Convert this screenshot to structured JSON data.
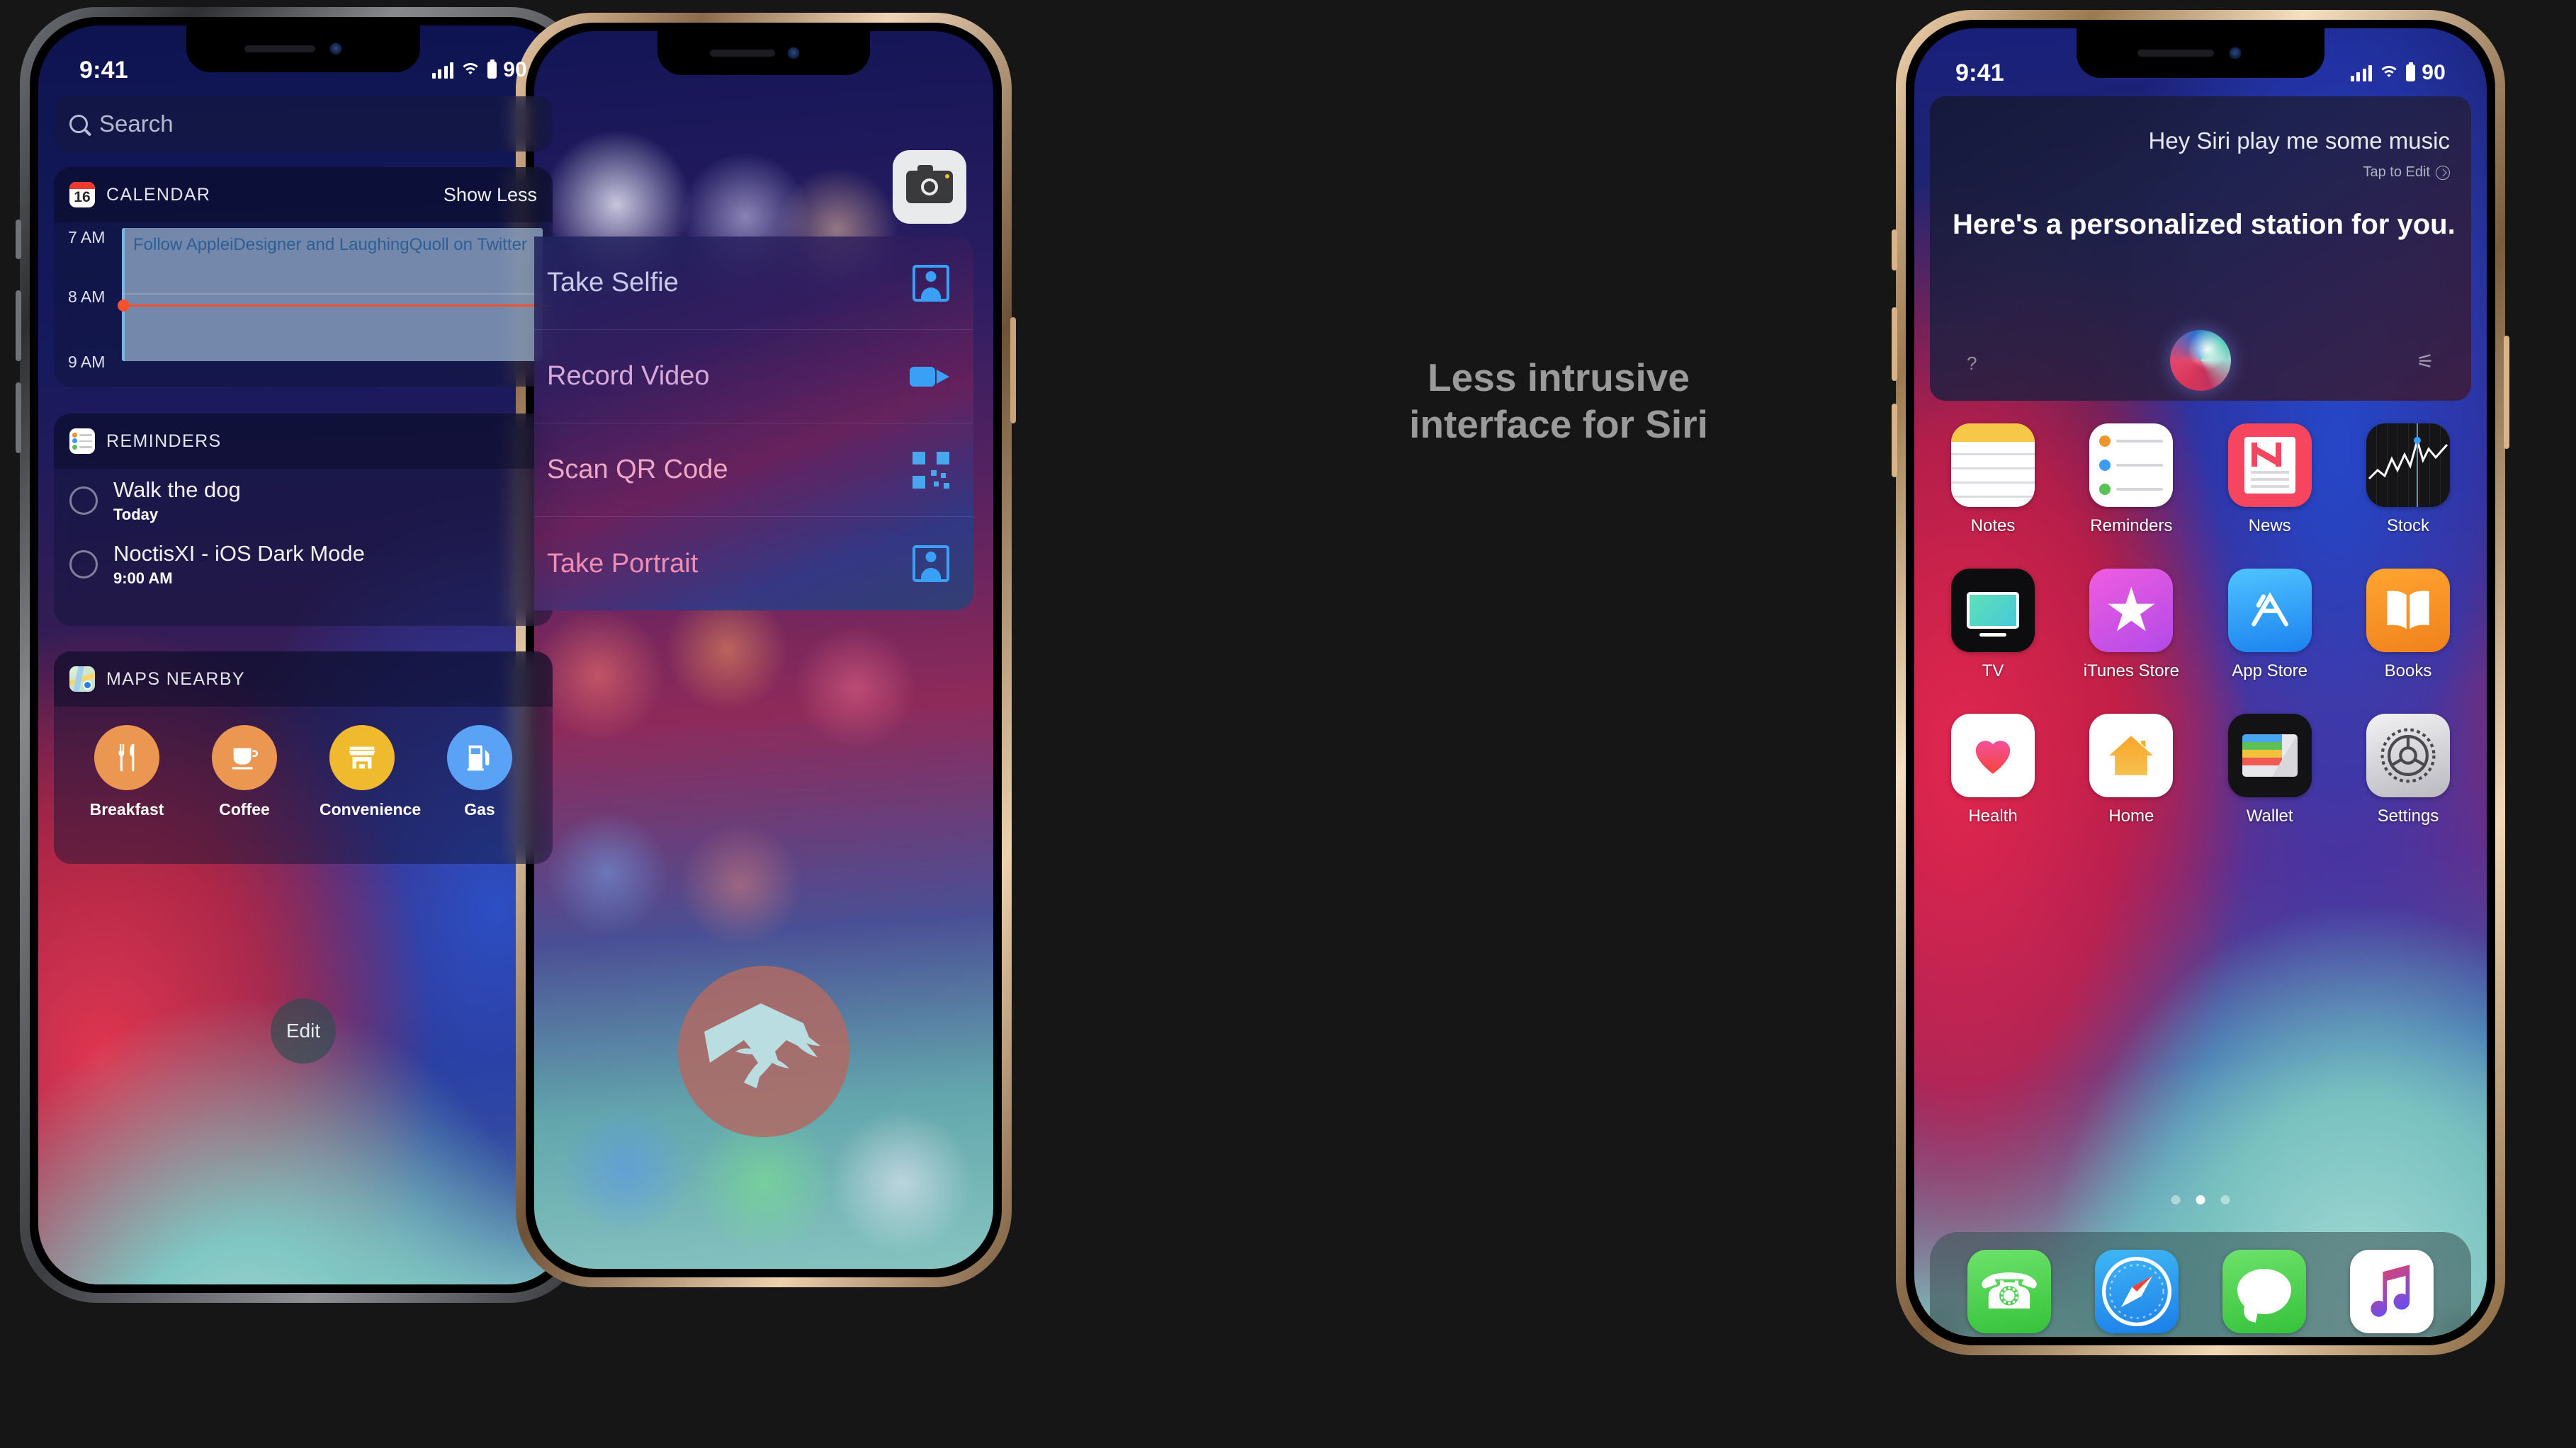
{
  "headline": {
    "line1": "Less intrusive",
    "line2": "interface for Siri",
    "color": "#9a9a9a"
  },
  "status_bar": {
    "time": "9:41",
    "battery_percent": "90",
    "signal_icon": "cellular-bars-icon",
    "wifi_icon": "wifi-icon",
    "battery_icon": "battery-icon"
  },
  "phone1": {
    "name": "Today View / Widgets",
    "search": {
      "placeholder": "Search",
      "icon": "search-icon"
    },
    "widgets": [
      {
        "id": "calendar",
        "title": "CALENDAR",
        "icon": "calendar-icon",
        "icon_day": "16",
        "action": "Show Less",
        "hours": [
          "7 AM",
          "8 AM",
          "9 AM"
        ],
        "event": {
          "title": "Follow AppleiDesigner and LaughingQuoll on Twitter"
        },
        "now_indicator_color": "#f4522e"
      },
      {
        "id": "reminders",
        "title": "REMINDERS",
        "icon": "reminders-icon",
        "items": [
          {
            "title": "Walk the dog",
            "subtitle": "Today"
          },
          {
            "title": "NoctisXI - iOS Dark Mode",
            "subtitle": "9:00 AM"
          }
        ]
      },
      {
        "id": "maps-nearby",
        "title": "MAPS NEARBY",
        "icon": "maps-icon",
        "categories": [
          {
            "label": "Breakfast",
            "icon": "fork-knife-icon",
            "color": "#ec9751"
          },
          {
            "label": "Coffee",
            "icon": "coffee-cup-icon",
            "color": "#ec9751"
          },
          {
            "label": "Convenience",
            "icon": "store-icon",
            "color": "#f0ba2e"
          },
          {
            "label": "Gas",
            "icon": "fuel-pump-icon",
            "color": "#5aa2f5"
          }
        ]
      }
    ],
    "edit_button": "Edit"
  },
  "phone2": {
    "name": "Camera quick actions",
    "app_icon": "camera-icon",
    "menu_items": [
      {
        "label": "Take Selfie",
        "icon": "portrait-person-icon",
        "color": "#c8c8e8"
      },
      {
        "label": "Record Video",
        "icon": "video-camera-icon",
        "color": "#d7a9d8"
      },
      {
        "label": "Scan QR Code",
        "icon": "qr-code-icon",
        "color": "#eda7c2"
      },
      {
        "label": "Take Portrait",
        "icon": "portrait-person-icon",
        "color": "#f08cb2"
      }
    ],
    "watermark": "quoll-logo-icon"
  },
  "phone3": {
    "name": "Siri result + Home screen",
    "siri": {
      "query": "Hey Siri play me some music",
      "edit_hint": "Tap to Edit",
      "edit_icon": "chevron-right-icon",
      "response": "Here's a personalized station for you.",
      "orb_icon": "siri-orb-icon",
      "help_icon": "help-question-icon",
      "mic_icon": "bluetooth-mic-icon"
    },
    "apps": [
      [
        {
          "label": "Notes",
          "icon": "notes-icon"
        },
        {
          "label": "Reminders",
          "icon": "reminders-icon"
        },
        {
          "label": "News",
          "icon": "news-icon"
        },
        {
          "label": "Stock",
          "icon": "stocks-icon"
        }
      ],
      [
        {
          "label": "TV",
          "icon": "tv-icon"
        },
        {
          "label": "iTunes Store",
          "icon": "itunes-store-icon"
        },
        {
          "label": "App Store",
          "icon": "app-store-icon"
        },
        {
          "label": "Books",
          "icon": "books-icon"
        }
      ],
      [
        {
          "label": "Health",
          "icon": "health-icon"
        },
        {
          "label": "Home",
          "icon": "home-icon"
        },
        {
          "label": "Wallet",
          "icon": "wallet-icon"
        },
        {
          "label": "Settings",
          "icon": "settings-gear-icon"
        }
      ]
    ],
    "page_dots": {
      "count": 3,
      "active_index": 1
    },
    "dock": [
      {
        "label": "Phone",
        "icon": "phone-icon"
      },
      {
        "label": "Safari",
        "icon": "safari-compass-icon"
      },
      {
        "label": "Messages",
        "icon": "messages-bubble-icon"
      },
      {
        "label": "Music",
        "icon": "music-note-icon"
      }
    ]
  }
}
